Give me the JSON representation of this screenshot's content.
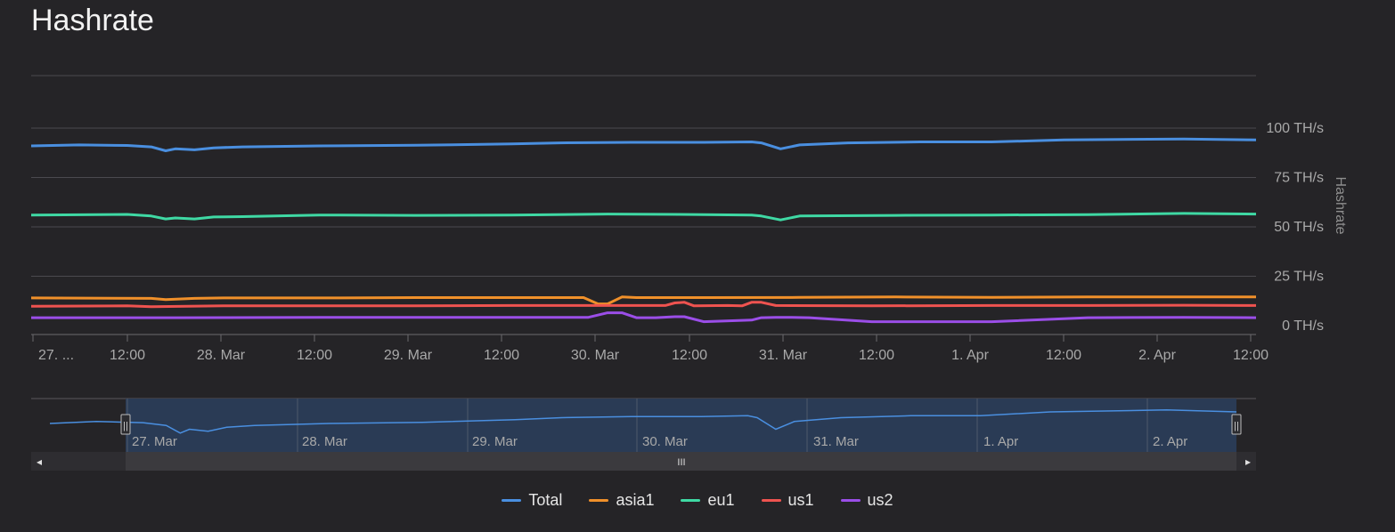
{
  "title": "Hashrate",
  "colors": {
    "background": "#252427",
    "grid": "#4b4a4f",
    "axis_text": "#a9a9a9",
    "navigator_fill": "#2a3b55",
    "scrollbar": "#3b3a3e"
  },
  "chart_data": {
    "type": "line",
    "ylabel": "Hashrate",
    "ylim": [
      0,
      100
    ],
    "y_ticks": [
      "0 TH/s",
      "25 TH/s",
      "50 TH/s",
      "75 TH/s",
      "100 TH/s"
    ],
    "x_ticks": [
      "27. ...",
      "12:00",
      "28. Mar",
      "12:00",
      "29. Mar",
      "12:00",
      "30. Mar",
      "12:00",
      "31. Mar",
      "12:00",
      "1. Apr",
      "12:00",
      "2. Apr",
      "12:00"
    ],
    "x_range": [
      "27. Mar 01:00",
      "2. Apr 12:00"
    ],
    "legend_position": "bottom-center",
    "series": [
      {
        "name": "Total",
        "color": "#4a8fe0",
        "x": [
          0,
          10,
          20,
          25,
          28,
          30,
          34,
          38,
          44,
          60,
          80,
          100,
          110,
          125,
          140,
          150,
          152,
          156,
          160,
          170,
          185,
          200,
          215,
          240,
          255
        ],
        "values": [
          91,
          91.5,
          91.2,
          90.5,
          88.5,
          89.5,
          89,
          90,
          90.5,
          91,
          91.3,
          92,
          92.5,
          92.8,
          92.8,
          93,
          92.5,
          89.5,
          91.5,
          92.5,
          93,
          93,
          94,
          94.5,
          94
        ]
      },
      {
        "name": "asia1",
        "color": "#f0902a",
        "x": [
          0,
          25,
          28,
          34,
          40,
          60,
          80,
          100,
          115,
          118,
          120,
          123,
          126,
          140,
          160,
          180,
          200,
          220,
          240,
          255
        ],
        "values": [
          14,
          13.8,
          13.2,
          13.8,
          14,
          14,
          14.2,
          14.2,
          14.2,
          11,
          11,
          14.5,
          14.2,
          14.2,
          14.3,
          14.5,
          14.3,
          14.5,
          14.5,
          14.5
        ]
      },
      {
        "name": "eu1",
        "color": "#3fd9a4",
        "x": [
          0,
          20,
          25,
          28,
          30,
          34,
          38,
          44,
          60,
          80,
          100,
          120,
          140,
          150,
          152,
          156,
          160,
          180,
          200,
          220,
          240,
          255
        ],
        "values": [
          56,
          56.3,
          55.5,
          54,
          54.5,
          54,
          55,
          55.2,
          56,
          55.8,
          56,
          56.5,
          56.2,
          56,
          55.5,
          53.5,
          55.5,
          55.8,
          56,
          56.2,
          56.8,
          56.5
        ]
      },
      {
        "name": "us1",
        "color": "#ef5350",
        "x": [
          0,
          20,
          25,
          40,
          60,
          80,
          100,
          120,
          132,
          134,
          136,
          138,
          145,
          148,
          150,
          152,
          155,
          175,
          200,
          220,
          240,
          255
        ],
        "values": [
          9.8,
          10,
          9.6,
          10,
          10,
          10,
          10.2,
          10.2,
          10.2,
          11.5,
          11.8,
          10,
          10.2,
          10,
          11.8,
          11.8,
          10.2,
          10,
          10.2,
          10.2,
          10.3,
          10.2
        ]
      },
      {
        "name": "us2",
        "color": "#9b4ee8",
        "x": [
          0,
          30,
          60,
          100,
          113,
          116,
          120,
          123,
          126,
          130,
          134,
          136,
          140,
          150,
          152,
          155,
          158,
          162,
          175,
          200,
          220,
          240,
          255
        ],
        "values": [
          4,
          4,
          4.2,
          4.2,
          4.2,
          4.2,
          6.5,
          6.5,
          4,
          4,
          4.5,
          4.5,
          2,
          2.8,
          4,
          4.2,
          4.2,
          4,
          2,
          2,
          4,
          4.2,
          4
        ]
      }
    ]
  },
  "navigator": {
    "labels": [
      "27. Mar",
      "28. Mar",
      "29. Mar",
      "30. Mar",
      "31. Mar",
      "1. Apr",
      "2. Apr"
    ],
    "handle_glyph": "||",
    "scroll_left_glyph": "◂",
    "scroll_right_glyph": "▸",
    "scroll_grip_glyph": "III"
  }
}
